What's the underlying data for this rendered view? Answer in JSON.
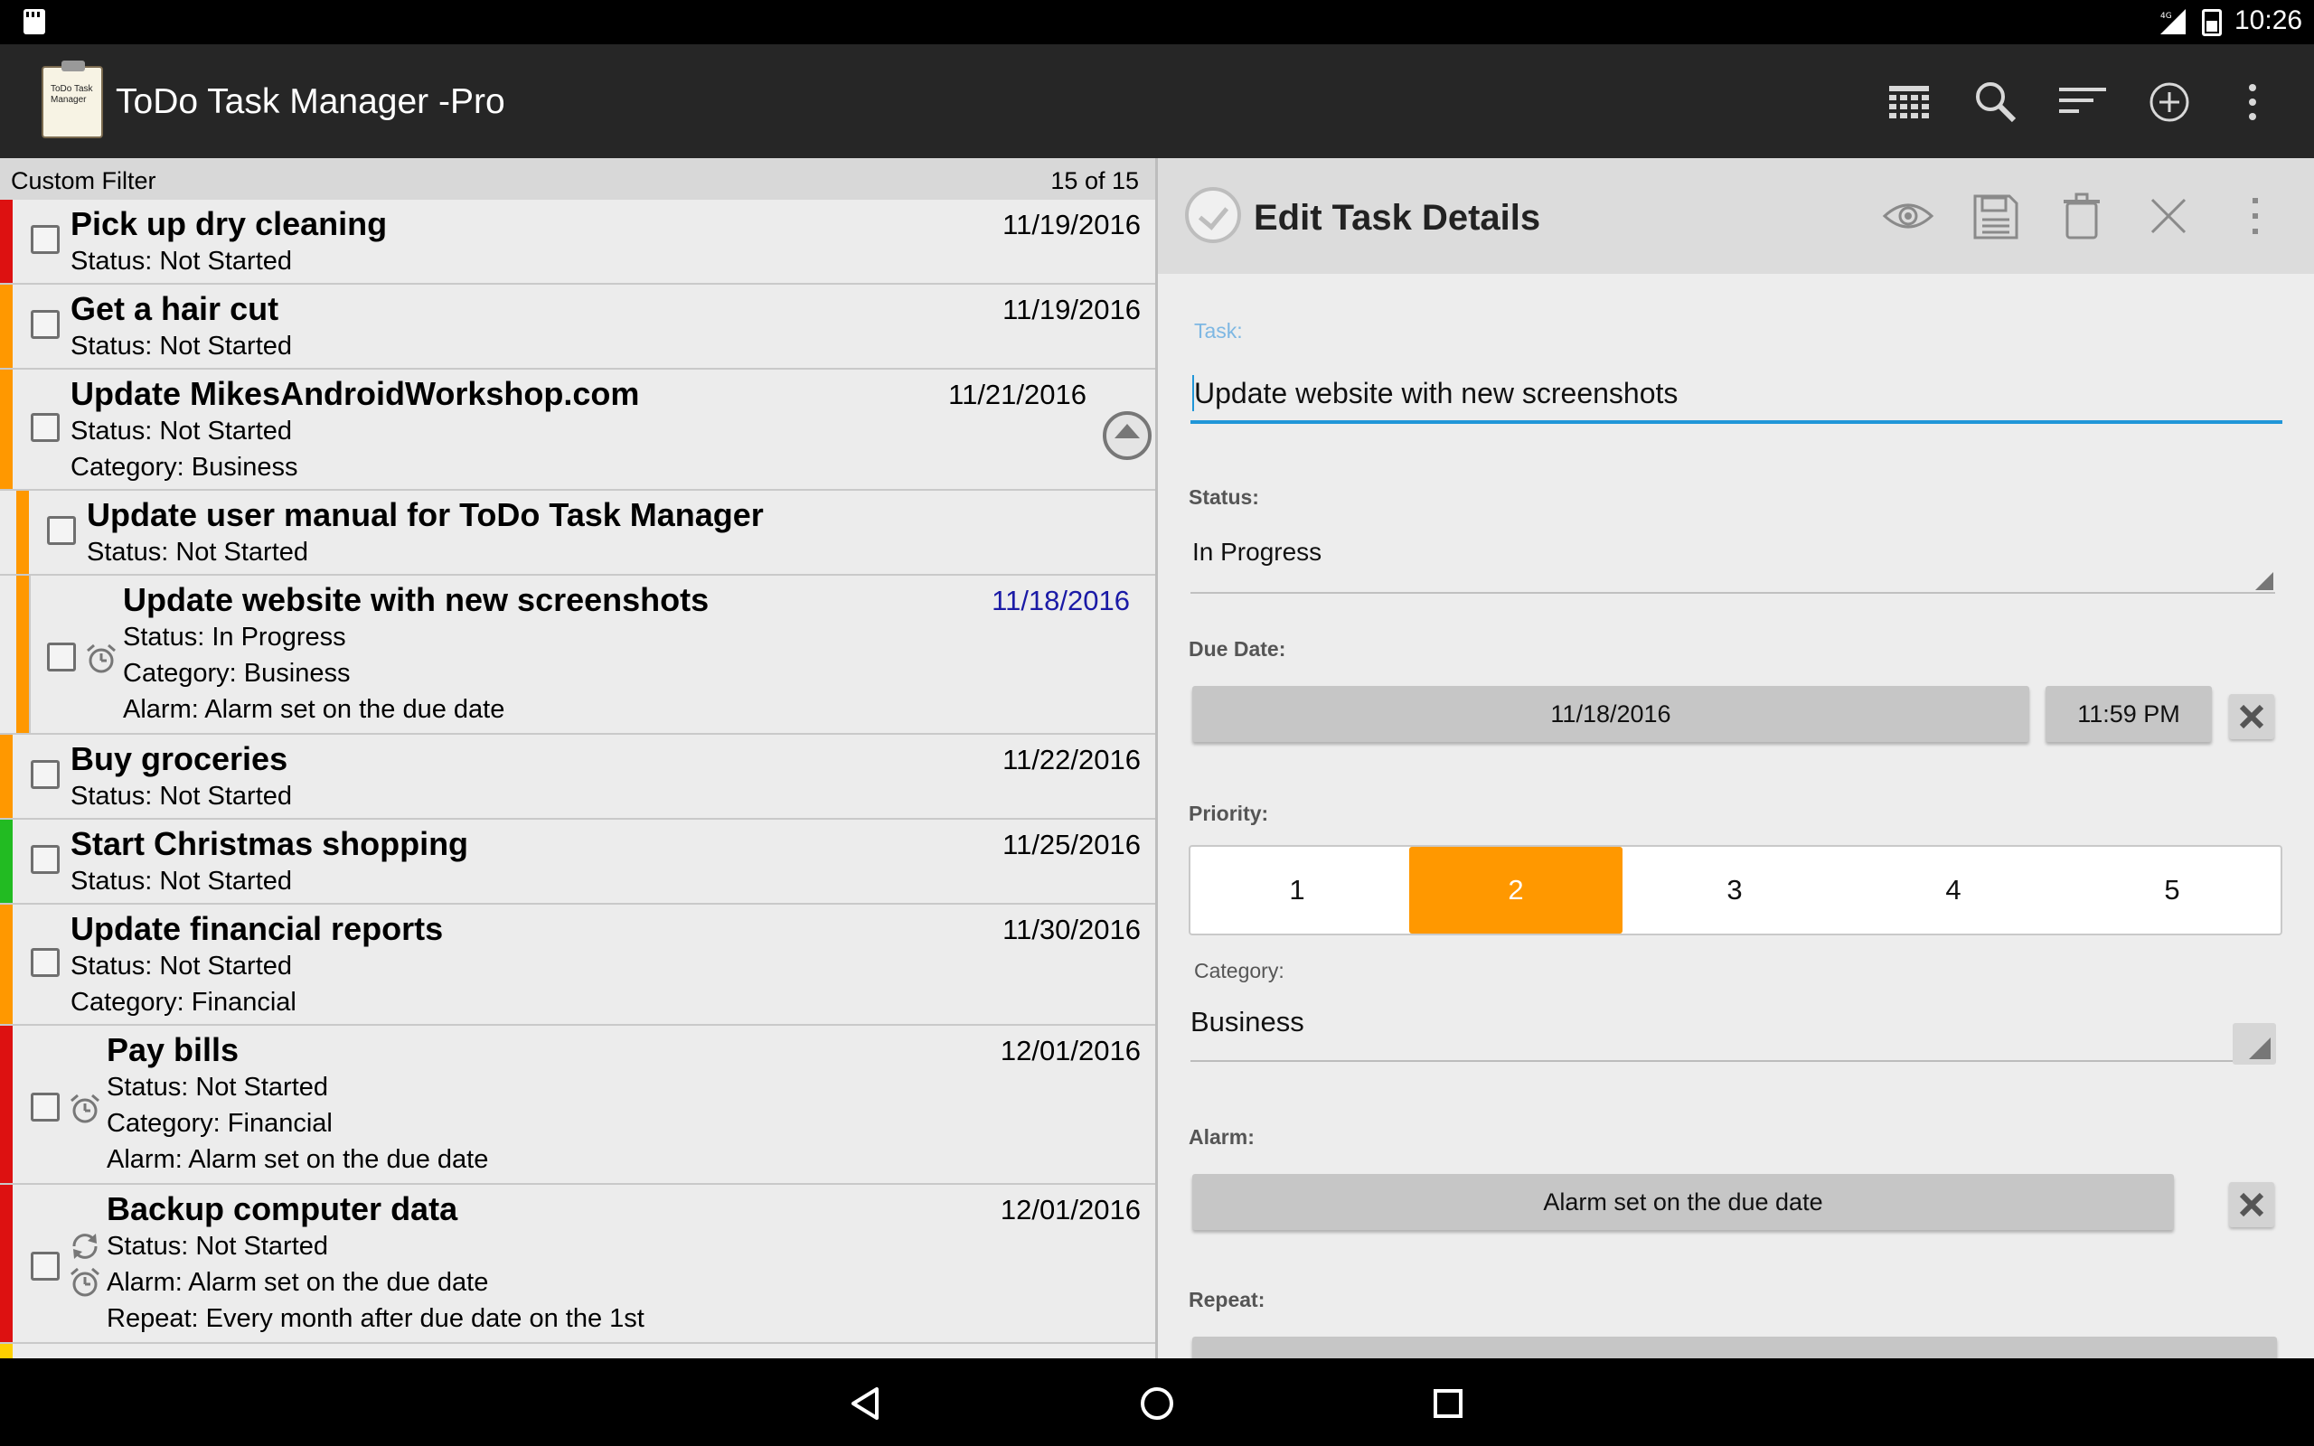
{
  "status_bar": {
    "network": "4G",
    "time": "10:26"
  },
  "app": {
    "title": "ToDo Task Manager -Pro",
    "logo_text": "ToDo Task Manager"
  },
  "list": {
    "filter_label": "Custom Filter",
    "count": "15 of 15",
    "tasks": [
      {
        "title": "Pick up dry cleaning",
        "date": "11/19/2016",
        "lines": [
          "Status: Not Started"
        ],
        "priority_color": "#dd1111"
      },
      {
        "title": "Get a hair cut",
        "date": "11/19/2016",
        "lines": [
          "Status: Not Started"
        ],
        "priority_color": "#ff9800"
      },
      {
        "title": "Update MikesAndroidWorkshop.com",
        "date": "11/21/2016",
        "lines": [
          "Status: Not Started",
          "Category: Business"
        ],
        "priority_color": "#ff9800"
      },
      {
        "title": "Update user manual for ToDo Task Manager",
        "date": "",
        "lines": [
          "Status: Not Started"
        ],
        "priority_color": "#ff9800"
      },
      {
        "title": "Update website with new screenshots",
        "date": "11/18/2016",
        "lines": [
          "Status: In Progress",
          "Category: Business",
          "Alarm: Alarm set on the due date"
        ],
        "priority_color": "#ff9800"
      },
      {
        "title": "Buy groceries",
        "date": "11/22/2016",
        "lines": [
          "Status: Not Started"
        ],
        "priority_color": "#ff9800"
      },
      {
        "title": "Start Christmas shopping",
        "date": "11/25/2016",
        "lines": [
          "Status: Not Started"
        ],
        "priority_color": "#22bb22"
      },
      {
        "title": "Update financial reports",
        "date": "11/30/2016",
        "lines": [
          "Status: Not Started",
          "Category: Financial"
        ],
        "priority_color": "#ff9800"
      },
      {
        "title": "Pay bills",
        "date": "12/01/2016",
        "lines": [
          "Status: Not Started",
          "Category: Financial",
          "Alarm: Alarm set on the due date"
        ],
        "priority_color": "#dd1111"
      },
      {
        "title": "Backup computer data",
        "date": "12/01/2016",
        "lines": [
          "Status: Not Started",
          "Alarm: Alarm set on the due date",
          "Repeat: Every month after due date on the 1st"
        ],
        "priority_color": "#dd1111"
      }
    ]
  },
  "detail": {
    "header_title": "Edit Task Details",
    "task_label": "Task:",
    "task_value": "Update website with new screenshots",
    "status_label": "Status:",
    "status_value": "In Progress",
    "due_date_label": "Due Date:",
    "due_date": "11/18/2016",
    "due_time": "11:59 PM",
    "priority_label": "Priority:",
    "priority_options": [
      "1",
      "2",
      "3",
      "4",
      "5"
    ],
    "priority_selected": "2",
    "category_label": "Category:",
    "category_value": "Business",
    "alarm_label": "Alarm:",
    "alarm_value": "Alarm set on the due date",
    "repeat_label": "Repeat:"
  },
  "colors": {
    "accent": "#2196d8",
    "priority_selected": "#ff9800",
    "action_bar": "#262626"
  }
}
